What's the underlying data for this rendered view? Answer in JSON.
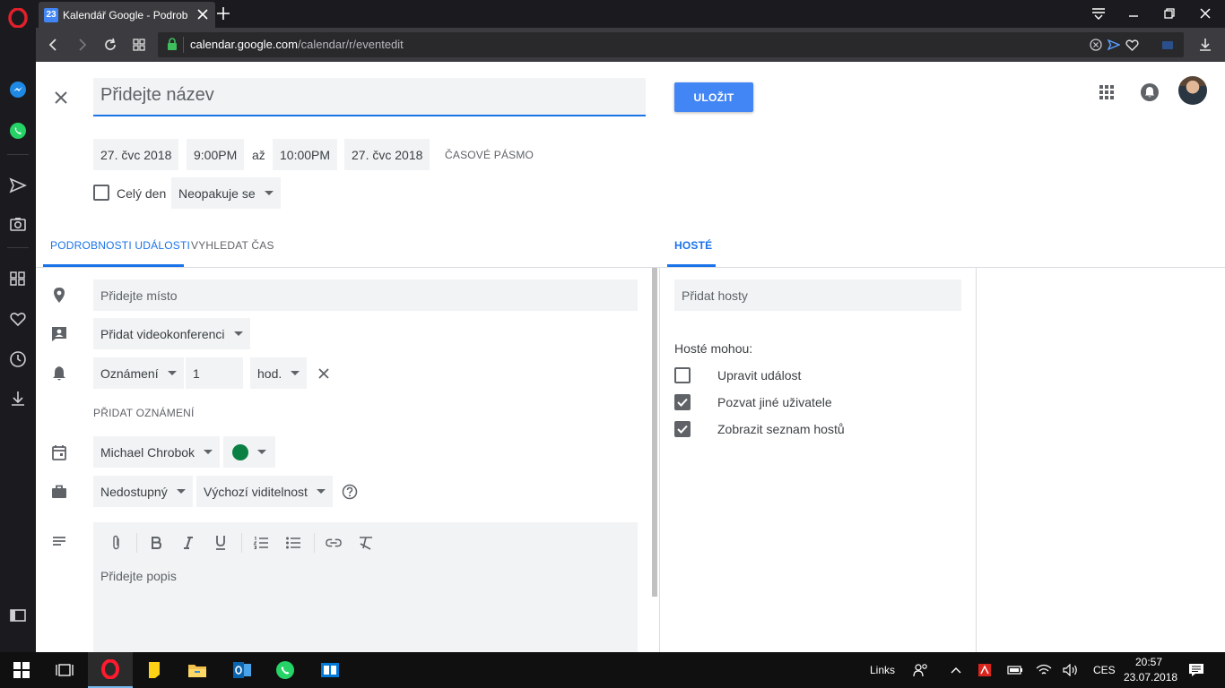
{
  "browser": {
    "tab_title": "Kalendář Google - Podrob",
    "tab_favicon_text": "23",
    "url_host": "calendar.google.com",
    "url_path": "/calendar/r/eventedit"
  },
  "event": {
    "title_placeholder": "Přidejte název",
    "save_label": "ULOŽIT",
    "start_date": "27. čvc 2018",
    "start_time": "9:00PM",
    "to_label": "až",
    "end_time": "10:00PM",
    "end_date": "27. čvc 2018",
    "timezone_label": "ČASOVÉ PÁSMO",
    "all_day_label": "Celý den",
    "repeat_value": "Neopakuje se"
  },
  "tabs": {
    "details": "PODROBNOSTI UDÁLOSTI",
    "find_time": "VYHLEDAT ČAS",
    "guests": "HOSTÉ"
  },
  "details": {
    "location_placeholder": "Přidejte místo",
    "video_conf": "Přidat videokonferenci",
    "notif_type": "Oznámení",
    "notif_amount": "1",
    "notif_unit": "hod.",
    "add_notification": "PŘIDAT OZNÁMENÍ",
    "calendar_owner": "Michael Chrobok",
    "event_color": "#0b8043",
    "availability": "Nedostupný",
    "visibility": "Výchozí viditelnost",
    "description_placeholder": "Přidejte popis"
  },
  "guests": {
    "add_placeholder": "Přidat hosty",
    "can_label": "Hosté mohou:",
    "permissions": [
      {
        "label": "Upravit událost",
        "checked": false
      },
      {
        "label": "Pozvat jiné uživatele",
        "checked": true
      },
      {
        "label": "Zobrazit seznam hostů",
        "checked": true
      }
    ]
  },
  "taskbar": {
    "links_label": "Links",
    "language": "CES",
    "time": "20:57",
    "date": "23.07.2018"
  },
  "colors": {
    "accent": "#1a73e8",
    "save_button": "#4285f4"
  }
}
